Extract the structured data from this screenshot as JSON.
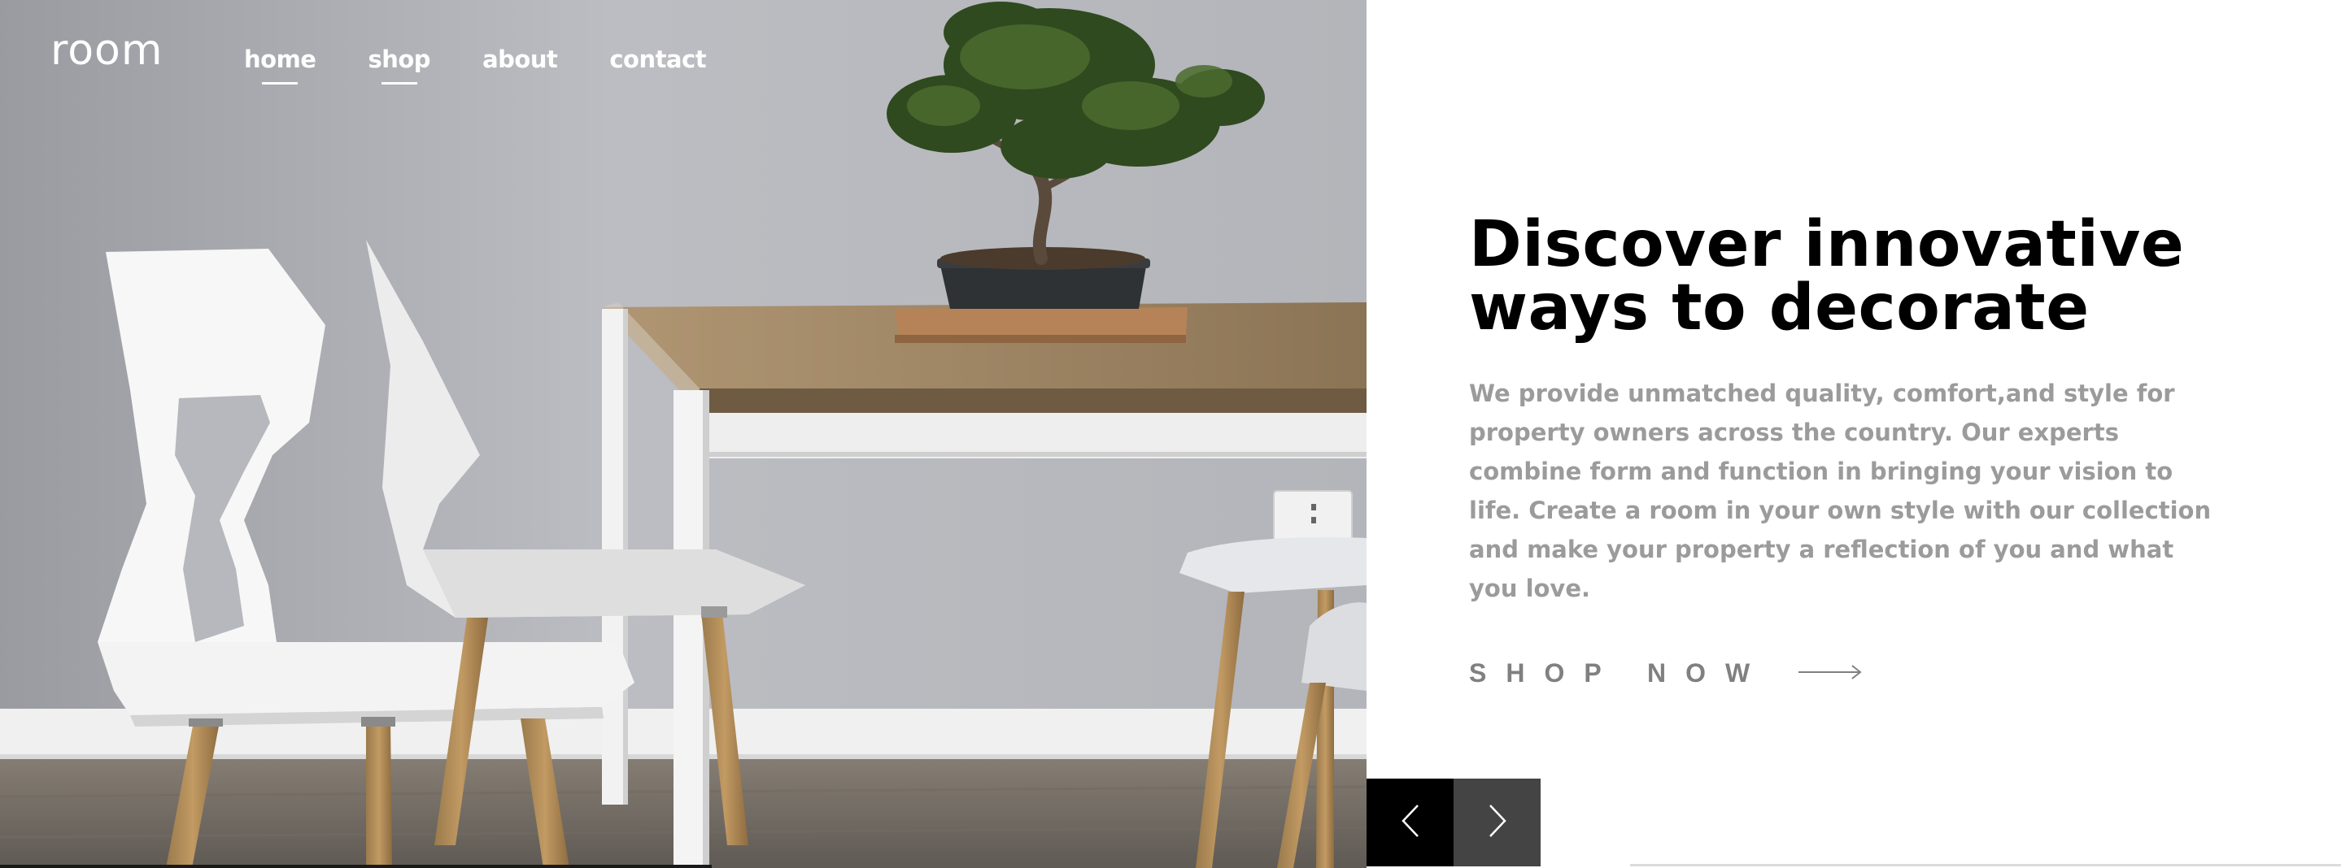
{
  "brand": {
    "logo": "room"
  },
  "nav": {
    "items": [
      {
        "label": "home"
      },
      {
        "label": "shop"
      },
      {
        "label": "about"
      },
      {
        "label": "contact"
      }
    ]
  },
  "hero": {
    "image_alt_icon": "dining-room-photo",
    "headline": "Discover innovative ways to decorate",
    "description": "We provide unmatched quality, comfort,and style for property owners across the country. Our experts combine form and function in bringing your vision to life. Create a room in your own style with our collection and make your property a reflection of you and what you love.",
    "cta_label": "SHOP NOW",
    "cta_icon": "arrow-right-icon"
  },
  "slider": {
    "prev_icon": "chevron-left-icon",
    "next_icon": "chevron-right-icon"
  },
  "colors": {
    "headline": "#000000",
    "body_text": "#9b9b9b",
    "cta_text": "#808080",
    "prev_button_bg": "#000000",
    "next_button_bg": "#444444",
    "nav_text": "#ffffff"
  }
}
